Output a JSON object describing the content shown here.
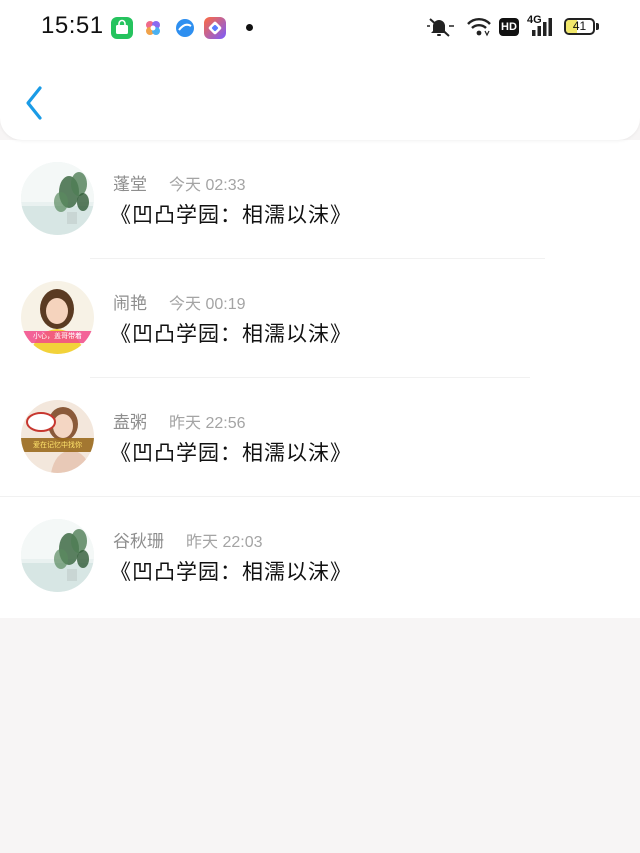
{
  "status_bar": {
    "time": "15:51",
    "battery_level": "41",
    "network": "4G",
    "hd_label": "HD"
  },
  "nav": {
    "back_icon": "chevron-left-icon"
  },
  "messages": [
    {
      "name": "蓬堂",
      "time": "今天 02:33",
      "text": "《凹凸学园：相濡以沫》"
    },
    {
      "name": "闹艳",
      "time": "今天 00:19",
      "text": "《凹凸学园：相濡以沫》"
    },
    {
      "name": "盍粥",
      "time": "昨天 22:56",
      "text": "《凹凸学园：相濡以沫》"
    },
    {
      "name": "谷秋珊",
      "time": "昨天 22:03",
      "text": "《凹凸学园：相濡以沫》"
    }
  ],
  "avatars": [
    {
      "icon": "plant-photo-avatar",
      "caption": ""
    },
    {
      "icon": "girl-photo-avatar",
      "caption": "小心，盖哥带着"
    },
    {
      "icon": "girl-photo-avatar",
      "caption": "爱在记忆中找你"
    },
    {
      "icon": "plant-photo-avatar",
      "caption": ""
    }
  ],
  "colors": {
    "accent": "#1a9be6",
    "background": "#f7f5f5",
    "card": "#ffffff"
  }
}
